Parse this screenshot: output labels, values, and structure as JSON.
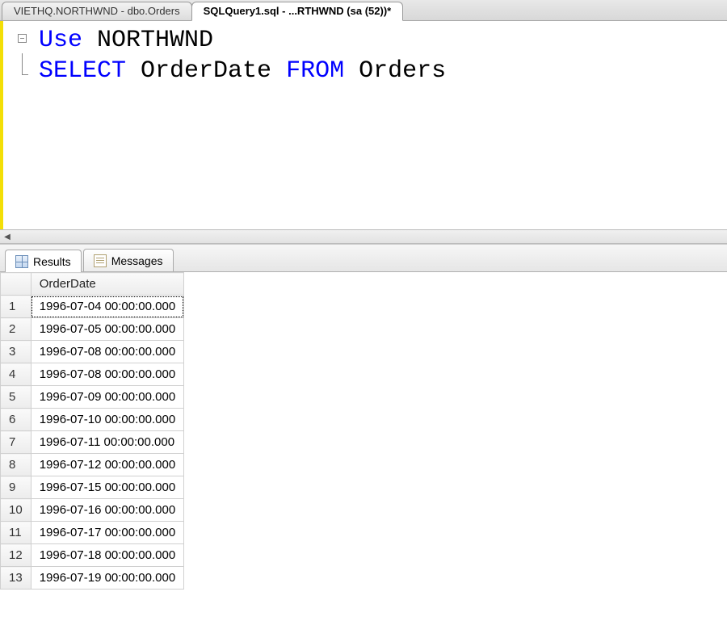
{
  "tabs": [
    {
      "label": "VIETHQ.NORTHWND - dbo.Orders",
      "active": false
    },
    {
      "label": "SQLQuery1.sql - ...RTHWND (sa (52))*",
      "active": true
    }
  ],
  "editor": {
    "line1": {
      "kw": "Use",
      "rest": " NORTHWND"
    },
    "line2": {
      "kw1": "SELECT",
      "mid": " OrderDate ",
      "kw2": "FROM",
      "rest": " Orders"
    }
  },
  "results_tabs": {
    "results": "Results",
    "messages": "Messages"
  },
  "grid": {
    "column": "OrderDate",
    "rows": [
      "1996-07-04 00:00:00.000",
      "1996-07-05 00:00:00.000",
      "1996-07-08 00:00:00.000",
      "1996-07-08 00:00:00.000",
      "1996-07-09 00:00:00.000",
      "1996-07-10 00:00:00.000",
      "1996-07-11 00:00:00.000",
      "1996-07-12 00:00:00.000",
      "1996-07-15 00:00:00.000",
      "1996-07-16 00:00:00.000",
      "1996-07-17 00:00:00.000",
      "1996-07-18 00:00:00.000",
      "1996-07-19 00:00:00.000"
    ]
  }
}
